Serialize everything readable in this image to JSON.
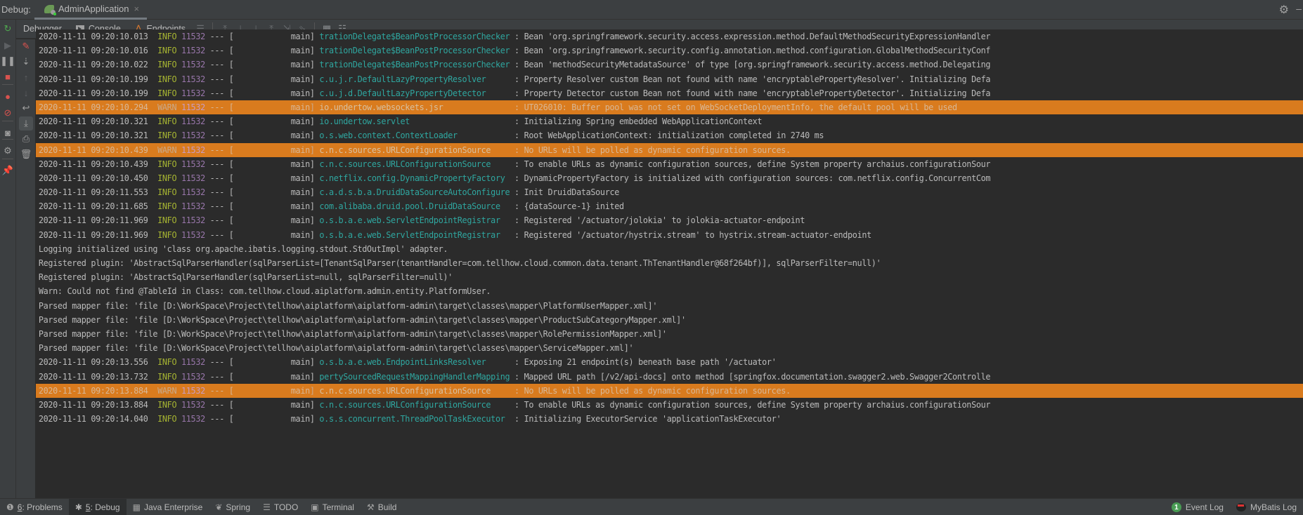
{
  "titlebar": {
    "debug_label": "Debug:",
    "run_tab_label": "AdminApplication",
    "close_glyph": "×",
    "settings_glyph": "⚙",
    "minimize_glyph": "–"
  },
  "toolbar": {
    "tabs": [
      {
        "label": "Debugger",
        "icon": "none"
      },
      {
        "label": "Console",
        "icon": "console-icon"
      },
      {
        "label": "Endpoints",
        "icon": "endpoints-icon"
      }
    ],
    "buttons": [
      {
        "name": "frames-menu",
        "glyph": "☰"
      },
      {
        "name": "show-execution-point",
        "glyph": "⤒"
      },
      {
        "name": "step-over",
        "glyph": "⤓"
      },
      {
        "name": "step-into",
        "glyph": "⤓"
      },
      {
        "name": "step-out",
        "glyph": "⤒"
      },
      {
        "name": "drop-frame",
        "glyph": "⇲"
      },
      {
        "name": "run-to-cursor",
        "glyph": "⇘"
      },
      {
        "name": "evaluate-expression",
        "glyph": "▦"
      },
      {
        "name": "trace-stream",
        "glyph": "☷"
      }
    ]
  },
  "leftstrip": [
    {
      "name": "rerun",
      "glyph": "↻",
      "color": "#4fa84f"
    },
    {
      "name": "resume",
      "glyph": "▶",
      "color": "#5d6063"
    },
    {
      "name": "pause",
      "glyph": "❚❚",
      "color": "#a0a0a0"
    },
    {
      "name": "stop",
      "glyph": "■",
      "color": "#d9534f"
    },
    {
      "name": "view-breakpoints",
      "glyph": "●",
      "color": "#d9534f"
    },
    {
      "name": "mute-breakpoints",
      "glyph": "⊘",
      "color": "#d9534f"
    },
    {
      "name": "camera",
      "glyph": "◙",
      "color": "#a0a0a0"
    },
    {
      "name": "settings",
      "glyph": "⚙",
      "color": "#a0a0a0"
    },
    {
      "name": "pin",
      "glyph": "📌",
      "color": "#a0a0a0"
    }
  ],
  "consolestrip": [
    {
      "name": "clear-all",
      "glyph": "✎",
      "color": "#d9534f"
    },
    {
      "name": "scroll-to-stacktrace",
      "glyph": "⇣",
      "color": "#a0a0a0"
    },
    {
      "name": "up-stacktrace",
      "glyph": "↑",
      "color": "#5d6063"
    },
    {
      "name": "down-stacktrace",
      "glyph": "↓",
      "color": "#5d6063"
    },
    {
      "name": "soft-wrap",
      "glyph": "↩",
      "color": "#a0a0a0"
    },
    {
      "name": "scroll-to-end",
      "glyph": "⤓",
      "color": "#a0a0a0"
    },
    {
      "name": "print",
      "glyph": "⎙",
      "color": "#a0a0a0"
    },
    {
      "name": "trash",
      "glyph": "🗑",
      "color": "#a0a0a0"
    }
  ],
  "console": {
    "lines": [
      {
        "type": "log",
        "ts": "2020-11-11 09:20:10.013",
        "level": "INFO",
        "pid": "11532",
        "thread": "main",
        "logger": "trationDelegate$BeanPostProcessorChecker",
        "msg": "Bean 'org.springframework.security.access.expression.method.DefaultMethodSecurityExpressionHandler"
      },
      {
        "type": "log",
        "ts": "2020-11-11 09:20:10.016",
        "level": "INFO",
        "pid": "11532",
        "thread": "main",
        "logger": "trationDelegate$BeanPostProcessorChecker",
        "msg": "Bean 'org.springframework.security.config.annotation.method.configuration.GlobalMethodSecurityConf"
      },
      {
        "type": "log",
        "ts": "2020-11-11 09:20:10.022",
        "level": "INFO",
        "pid": "11532",
        "thread": "main",
        "logger": "trationDelegate$BeanPostProcessorChecker",
        "msg": "Bean 'methodSecurityMetadataSource' of type [org.springframework.security.access.method.Delegating"
      },
      {
        "type": "log",
        "ts": "2020-11-11 09:20:10.199",
        "level": "INFO",
        "pid": "11532",
        "thread": "main",
        "logger": "c.u.j.r.DefaultLazyPropertyResolver",
        "msg": "Property Resolver custom Bean not found with name 'encryptablePropertyResolver'. Initializing Defa"
      },
      {
        "type": "log",
        "ts": "2020-11-11 09:20:10.199",
        "level": "INFO",
        "pid": "11532",
        "thread": "main",
        "logger": "c.u.j.d.DefaultLazyPropertyDetector",
        "msg": "Property Detector custom Bean not found with name 'encryptablePropertyDetector'. Initializing Defa"
      },
      {
        "type": "log",
        "ts": "2020-11-11 09:20:10.294",
        "level": "WARN",
        "pid": "11532",
        "thread": "main",
        "logger": "io.undertow.websockets.jsr",
        "msg": "UT026010: Buffer pool was not set on WebSocketDeploymentInfo, the default pool will be used"
      },
      {
        "type": "log",
        "ts": "2020-11-11 09:20:10.321",
        "level": "INFO",
        "pid": "11532",
        "thread": "main",
        "logger": "io.undertow.servlet",
        "msg": "Initializing Spring embedded WebApplicationContext"
      },
      {
        "type": "log",
        "ts": "2020-11-11 09:20:10.321",
        "level": "INFO",
        "pid": "11532",
        "thread": "main",
        "logger": "o.s.web.context.ContextLoader",
        "msg": "Root WebApplicationContext: initialization completed in 2740 ms"
      },
      {
        "type": "log",
        "ts": "2020-11-11 09:20:10.439",
        "level": "WARN",
        "pid": "11532",
        "thread": "main",
        "logger": "c.n.c.sources.URLConfigurationSource",
        "msg": "No URLs will be polled as dynamic configuration sources."
      },
      {
        "type": "log",
        "ts": "2020-11-11 09:20:10.439",
        "level": "INFO",
        "pid": "11532",
        "thread": "main",
        "logger": "c.n.c.sources.URLConfigurationSource",
        "msg": "To enable URLs as dynamic configuration sources, define System property archaius.configurationSour"
      },
      {
        "type": "log",
        "ts": "2020-11-11 09:20:10.450",
        "level": "INFO",
        "pid": "11532",
        "thread": "main",
        "logger": "c.netflix.config.DynamicPropertyFactory",
        "msg": "DynamicPropertyFactory is initialized with configuration sources: com.netflix.config.ConcurrentCom"
      },
      {
        "type": "log",
        "ts": "2020-11-11 09:20:11.553",
        "level": "INFO",
        "pid": "11532",
        "thread": "main",
        "logger": "c.a.d.s.b.a.DruidDataSourceAutoConfigure",
        "msg": "Init DruidDataSource"
      },
      {
        "type": "log",
        "ts": "2020-11-11 09:20:11.685",
        "level": "INFO",
        "pid": "11532",
        "thread": "main",
        "logger": "com.alibaba.druid.pool.DruidDataSource",
        "msg": "{dataSource-1} inited"
      },
      {
        "type": "log",
        "ts": "2020-11-11 09:20:11.969",
        "level": "INFO",
        "pid": "11532",
        "thread": "main",
        "logger": "o.s.b.a.e.web.ServletEndpointRegistrar",
        "msg": "Registered '/actuator/jolokia' to jolokia-actuator-endpoint"
      },
      {
        "type": "log",
        "ts": "2020-11-11 09:20:11.969",
        "level": "INFO",
        "pid": "11532",
        "thread": "main",
        "logger": "o.s.b.a.e.web.ServletEndpointRegistrar",
        "msg": "Registered '/actuator/hystrix.stream' to hystrix.stream-actuator-endpoint"
      },
      {
        "type": "plain",
        "text": "Logging initialized using 'class org.apache.ibatis.logging.stdout.StdOutImpl' adapter."
      },
      {
        "type": "plain",
        "text": "Registered plugin: 'AbstractSqlParserHandler(sqlParserList=[TenantSqlParser(tenantHandler=com.tellhow.cloud.common.data.tenant.ThTenantHandler@68f264bf)], sqlParserFilter=null)'"
      },
      {
        "type": "plain",
        "text": "Registered plugin: 'AbstractSqlParserHandler(sqlParserList=null, sqlParserFilter=null)'"
      },
      {
        "type": "plain",
        "text": "Warn: Could not find @TableId in Class: com.tellhow.cloud.aiplatform.admin.entity.PlatformUser."
      },
      {
        "type": "plain",
        "text": "Parsed mapper file: 'file [D:\\WorkSpace\\Project\\tellhow\\aiplatform\\aiplatform-admin\\target\\classes\\mapper\\PlatformUserMapper.xml]'"
      },
      {
        "type": "plain",
        "text": "Parsed mapper file: 'file [D:\\WorkSpace\\Project\\tellhow\\aiplatform\\aiplatform-admin\\target\\classes\\mapper\\ProductSubCategoryMapper.xml]'"
      },
      {
        "type": "plain",
        "text": "Parsed mapper file: 'file [D:\\WorkSpace\\Project\\tellhow\\aiplatform\\aiplatform-admin\\target\\classes\\mapper\\RolePermissionMapper.xml]'"
      },
      {
        "type": "plain",
        "text": "Parsed mapper file: 'file [D:\\WorkSpace\\Project\\tellhow\\aiplatform\\aiplatform-admin\\target\\classes\\mapper\\ServiceMapper.xml]'"
      },
      {
        "type": "log",
        "ts": "2020-11-11 09:20:13.556",
        "level": "INFO",
        "pid": "11532",
        "thread": "main",
        "logger": "o.s.b.a.e.web.EndpointLinksResolver",
        "msg": "Exposing 21 endpoint(s) beneath base path '/actuator'"
      },
      {
        "type": "log",
        "ts": "2020-11-11 09:20:13.732",
        "level": "INFO",
        "pid": "11532",
        "thread": "main",
        "logger": "pertySourcedRequestMappingHandlerMapping",
        "msg": "Mapped URL path [/v2/api-docs] onto method [springfox.documentation.swagger2.web.Swagger2Controlle"
      },
      {
        "type": "log",
        "ts": "2020-11-11 09:20:13.884",
        "level": "WARN",
        "pid": "11532",
        "thread": "main",
        "logger": "c.n.c.sources.URLConfigurationSource",
        "msg": "No URLs will be polled as dynamic configuration sources."
      },
      {
        "type": "log",
        "ts": "2020-11-11 09:20:13.884",
        "level": "INFO",
        "pid": "11532",
        "thread": "main",
        "logger": "c.n.c.sources.URLConfigurationSource",
        "msg": "To enable URLs as dynamic configuration sources, define System property archaius.configurationSour"
      },
      {
        "type": "log",
        "ts": "2020-11-11 09:20:14.040",
        "level": "INFO",
        "pid": "11532",
        "thread": "main",
        "logger": "o.s.s.concurrent.ThreadPoolTaskExecutor",
        "msg": "Initializing ExecutorService 'applicationTaskExecutor'"
      }
    ]
  },
  "bottombar": {
    "items": [
      {
        "name": "problems",
        "key": "6",
        "label": ": Problems",
        "glyph": "❶",
        "active": false
      },
      {
        "name": "debug",
        "key": "5",
        "label": ": Debug",
        "glyph": "✱",
        "active": true
      },
      {
        "name": "java-enterprise",
        "key": "",
        "label": "Java Enterprise",
        "glyph": "▦",
        "active": false
      },
      {
        "name": "spring",
        "key": "",
        "label": "Spring",
        "glyph": "❦",
        "active": false
      },
      {
        "name": "todo",
        "key": "",
        "label": "TODO",
        "glyph": "☰",
        "active": false
      },
      {
        "name": "terminal",
        "key": "",
        "label": "Terminal",
        "glyph": "▣",
        "active": false
      },
      {
        "name": "build",
        "key": "",
        "label": "Build",
        "glyph": "⚒",
        "active": false
      }
    ],
    "event_log": {
      "count": "1",
      "label": "Event Log"
    },
    "mybatis_log": {
      "label": "MyBatis Log"
    }
  },
  "colors": {
    "warn_background": "#d97b1e",
    "info_level": "#a7b532",
    "pid": "#9876aa",
    "logger": "#2fa7a0",
    "text": "#bbbbbb",
    "background": "#2b2b2b",
    "chrome": "#3c3f41"
  }
}
